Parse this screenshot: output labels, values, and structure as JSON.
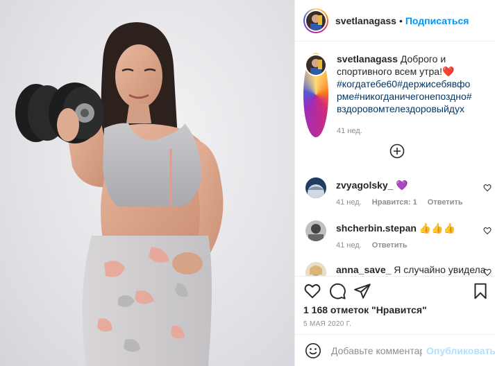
{
  "author": {
    "username": "svetlanagass",
    "separator": "•",
    "follow_label": "Подписаться"
  },
  "caption": {
    "username": "svetlanagass",
    "text": "Доброго и спортивного всем утра!",
    "emoji": "❤️",
    "hashtags": "#когдатебе60#держисебявформе#никогданичегонепоздно#вздоровомтелездоровыйдух",
    "time": "41 нед."
  },
  "comments": [
    {
      "username": "zvyagolsky_",
      "text": "💜",
      "time": "41 нед.",
      "likes": "Нравится: 1",
      "reply": "Ответить"
    },
    {
      "username": "shcherbin.stepan",
      "text": "👍👍👍",
      "time": "41 нед.",
      "reply": "Ответить"
    },
    {
      "username": "anna_save_",
      "text": "Я случайно увидела"
    }
  ],
  "likes_text": "1 168 отметок \"Нравится\"",
  "date": "5 МАЯ 2020 Г.",
  "comment_box": {
    "placeholder": "Добавьте комментарий...",
    "publish_label": "Опубликовать"
  },
  "icons": {
    "like": "heart-icon",
    "comment": "comment-icon",
    "share": "share-icon",
    "save": "bookmark-icon",
    "load_more": "plus-circle-icon",
    "emoji": "emoji-icon"
  },
  "colors": {
    "link": "#0095f6",
    "hashtag": "#00376b",
    "muted": "#8e8e8e",
    "heart": "#ed4956",
    "publish_disabled": "#b2dffc",
    "purple_heart": "#8e44ec"
  }
}
